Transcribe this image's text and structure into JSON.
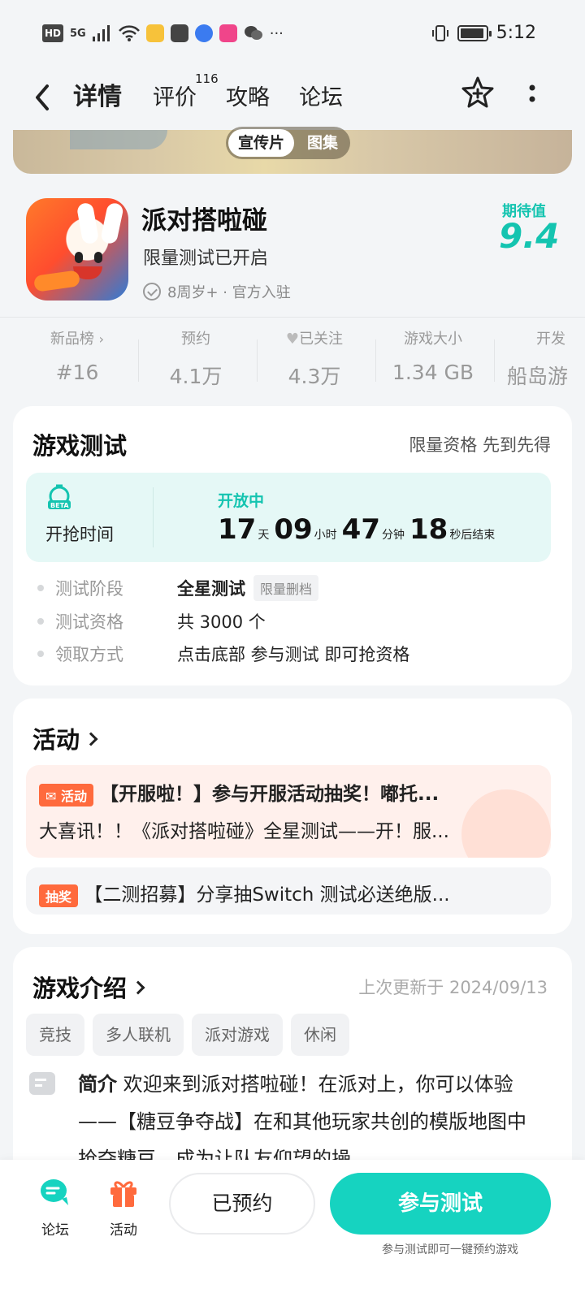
{
  "status_bar": {
    "hd": "HD",
    "network": "5G",
    "time": "5:12",
    "more": "···"
  },
  "nav": {
    "tabs": [
      "详情",
      "评价",
      "攻略",
      "论坛"
    ],
    "review_count": "116"
  },
  "media": {
    "options": [
      "宣传片",
      "图集"
    ],
    "selected": "宣传片"
  },
  "game": {
    "title": "派对搭啦碰",
    "subtitle": "限量测试已开启",
    "meta": "8周岁+ · 官方入驻",
    "expect_label": "期待值",
    "expect_value": "9.4"
  },
  "stats": [
    {
      "label": "新品榜",
      "value": "#16"
    },
    {
      "label": "预约",
      "value": "4.1万"
    },
    {
      "label": "已关注",
      "value": "4.3万"
    },
    {
      "label": "游戏大小",
      "value": "1.34 GB"
    },
    {
      "label": "开发",
      "value": "船岛游"
    }
  ],
  "test_card": {
    "title": "游戏测试",
    "right": "限量资格 先到先得",
    "beta_label": "BETA",
    "grab_time": "开抢时间",
    "status": "开放中",
    "countdown": {
      "days": "17",
      "days_unit": "天",
      "hours": "09",
      "hours_unit": "小时",
      "minutes": "47",
      "minutes_unit": "分钟",
      "seconds": "18",
      "seconds_unit": "秒后结束"
    },
    "rows": [
      {
        "key": "测试阶段",
        "value": "全星测试",
        "tag": "限量删档"
      },
      {
        "key": "测试资格",
        "value": "共 3000 个"
      },
      {
        "key": "领取方式",
        "value": "点击底部 参与测试 即可抢资格"
      }
    ]
  },
  "activity_card": {
    "title": "活动",
    "item1_tag": "活动",
    "item1_title": "【开服啦！】参与开服活动抽奖！嘟托...",
    "item1_desc": "大喜讯！！《派对搭啦碰》全星测试——开！服...",
    "item2_tag": "抽奖",
    "item2_title": "【二测招募】分享抽Switch 测试必送绝版..."
  },
  "intro_card": {
    "title": "游戏介绍",
    "update_note": "上次更新于 2024/09/13",
    "tags": [
      "竞技",
      "多人联机",
      "派对游戏",
      "休闲"
    ],
    "intro_label": "简介",
    "intro_text": "欢迎来到派对搭啦碰！在派对上，你可以体验——【糖豆争夺战】在和其他玩家共创的模版地图中抢夺糖豆，成为让队友仰望的操"
  },
  "bottom_bar": {
    "forum": "论坛",
    "activity": "活动",
    "reserved": "已预约",
    "join": "参与测试",
    "join_note": "参与测试即可一键预约游戏"
  },
  "colors": {
    "accent": "#16d3c0",
    "activity": "#ff6a3d"
  }
}
